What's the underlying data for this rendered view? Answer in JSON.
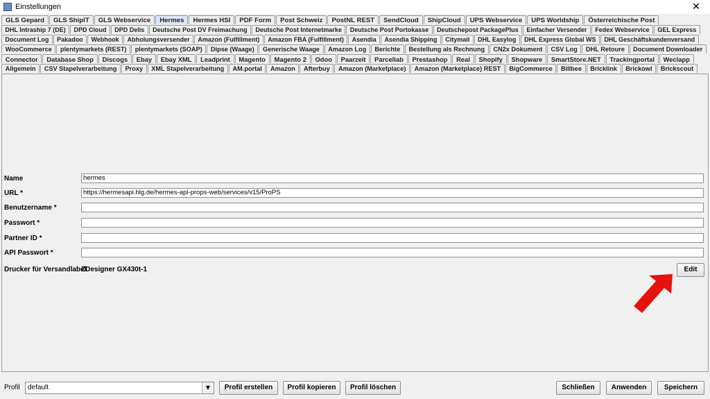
{
  "window": {
    "title": "Einstellungen",
    "close_glyph": "✕"
  },
  "tabs": {
    "row1": [
      "GLS Gepard",
      "GLS ShipIT",
      "GLS Webservice",
      "Hermes",
      "Hermes HSI",
      "PDF Form",
      "Post Schweiz",
      "PostNL REST",
      "SendCloud",
      "ShipCloud",
      "UPS Webservice",
      "UPS Worldship",
      "Österreichische Post"
    ],
    "row2": [
      "DHL Intraship 7 (DE)",
      "DPD Cloud",
      "DPD Delis",
      "Deutsche Post DV Freimachung",
      "Deutsche Post Internetmarke",
      "Deutsche Post Portokasse",
      "Deutschepost PackagePlus",
      "Einfacher Versender",
      "Fedex Webservice",
      "GEL Express"
    ],
    "row3": [
      "Document Log",
      "Pakadoo",
      "Webhook",
      "Abholungsversender",
      "Amazon (Fulfillment)",
      "Amazon FBA (Fulfillment)",
      "Asendia",
      "Asendia Shipping",
      "Citymail",
      "DHL Easylog",
      "DHL Express Global WS",
      "DHL Geschäftskundenversand"
    ],
    "row4": [
      "WooCommerce",
      "plentymarkets (REST)",
      "plentymarkets (SOAP)",
      "Dipse (Waage)",
      "Generische Waage",
      "Amazon Log",
      "Berichte",
      "Bestellung als Rechnung",
      "CN2x Dokument",
      "CSV Log",
      "DHL Retoure",
      "Document Downloader"
    ],
    "row5": [
      "Connector",
      "Database Shop",
      "Discogs",
      "Ebay",
      "Ebay XML",
      "Leadprint",
      "Magento",
      "Magento 2",
      "Odoo",
      "Paarzeit",
      "Parcellab",
      "Prestashop",
      "Real",
      "Shopify",
      "Shopware",
      "SmartStore.NET",
      "Trackingportal",
      "Weclapp"
    ],
    "row6": [
      "Allgemein",
      "CSV Stapelverarbeitung",
      "Proxy",
      "XML Stapelverarbeitung",
      "AM.portal",
      "Amazon",
      "Afterbuy",
      "Amazon (Marketplace)",
      "Amazon (Marketplace) REST",
      "BigCommerce",
      "Billbee",
      "Bricklink",
      "Brickowl",
      "Brickscout"
    ],
    "selected": "Hermes"
  },
  "form": {
    "name_label": "Name",
    "name_value": "hermes",
    "url_label": "URL *",
    "url_value": "https://hermesapi.hlg.de/hermes-api-props-web/services/v15/ProPS",
    "user_label": "Benutzername *",
    "user_value": "",
    "pass_label": "Passwort *",
    "pass_value": "",
    "partner_label": "Partner ID *",
    "partner_value": "",
    "apipass_label": "API Passwort *",
    "apipass_value": "",
    "printer_label": "Drucker für Versandlabel",
    "printer_value": "ZDesigner GX430t-1",
    "edit_label": "Edit"
  },
  "bottom": {
    "profile_label": "Profil",
    "profile_value": "default",
    "create_label": "Profil erstellen",
    "copy_label": "Profil kopieren",
    "delete_label": "Profil löschen",
    "close_label": "Schließen",
    "apply_label": "Anwenden",
    "save_label": "Speichern"
  },
  "colors": {
    "annotation_arrow": "#e8100c",
    "selected_tab": "#dbe7f7"
  }
}
